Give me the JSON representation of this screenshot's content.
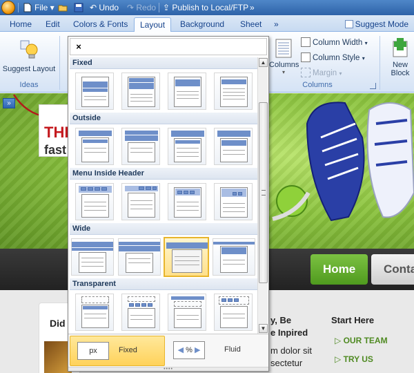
{
  "qat": {
    "file_label": "File",
    "undo_label": "Undo",
    "redo_label": "Redo",
    "publish_label": "Publish to Local/FTP",
    "more_label": "»"
  },
  "tabs": [
    "Home",
    "Edit",
    "Colors & Fonts",
    "Layout",
    "Background",
    "Sheet",
    "»"
  ],
  "active_tab": "Layout",
  "suggest_mode_label": "Suggest Mode",
  "ribbon": {
    "suggest_layout_label": "Suggest Layout",
    "ideas_group_label": "Ideas",
    "columns_label": "Columns",
    "column_width_label": "Column Width",
    "column_style_label": "Column Style",
    "margin_label": "Margin",
    "columns_group_label": "Columns",
    "new_block_line1": "New",
    "new_block_line2": "Block"
  },
  "canvas": {
    "expand_label": "»",
    "headline": "THE",
    "subline": "fast",
    "nav_home": "Home",
    "nav_contact": "Conta",
    "card_title": "Did",
    "mid_heading_1": "y, Be",
    "mid_heading_2": "e Inpired",
    "mid_body_1": "m dolor sit",
    "mid_body_2": "sectetur",
    "start_here": "Start Here",
    "link_team": "OUR TEAM",
    "link_try": "TRY US"
  },
  "gallery": {
    "close_label": "×",
    "sections": [
      {
        "title": "Fixed"
      },
      {
        "title": "Outside"
      },
      {
        "title": "Menu Inside Header"
      },
      {
        "title": "Wide"
      },
      {
        "title": "Transparent"
      }
    ],
    "selected": "Wide 3",
    "width_options": {
      "fixed_unit": "px",
      "fixed_label": "Fixed",
      "fluid_unit": "%",
      "fluid_label": "Fluid",
      "selected": "Fixed"
    }
  },
  "colors": {
    "accent": "#e8b52b",
    "ribbon_text": "#15428b",
    "nav_green": "#5aa326",
    "hero_green": "#8cc43f"
  }
}
